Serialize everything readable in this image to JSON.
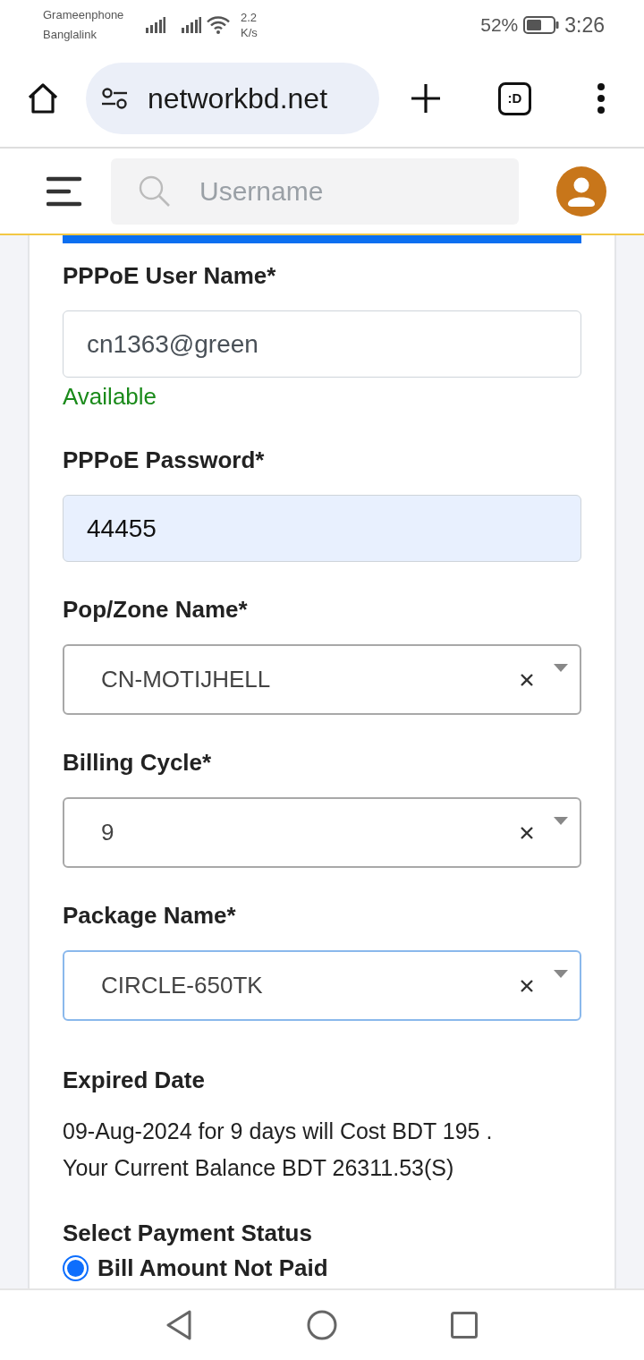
{
  "status_bar": {
    "carriers": [
      "Grameenphone",
      "Banglalink"
    ],
    "speed": [
      "2.2",
      "K/s"
    ],
    "battery": "52%",
    "time": "3:26"
  },
  "browser_bar": {
    "url": "networkbd.net",
    "tab_switcher": ":D"
  },
  "app_header": {
    "search": {
      "placeholder": "Username"
    }
  },
  "form": {
    "fields": [
      {
        "kind": "text",
        "label": "PPPoE User Name*",
        "value": "cn1363@green",
        "hint": "Available",
        "autofilled": false
      },
      {
        "kind": "text",
        "label": "PPPoE Password*",
        "value": "44455",
        "autofilled": true
      },
      {
        "kind": "select",
        "label": "Pop/Zone Name*",
        "value": "CN-MOTIJHELL",
        "focused": false
      },
      {
        "kind": "select",
        "label": "Billing Cycle*",
        "value": "9",
        "focused": false
      },
      {
        "kind": "select",
        "label": "Package Name*",
        "value": "CIRCLE-650TK",
        "focused": true
      }
    ],
    "expired_date": {
      "label": "Expired Date",
      "lines": [
        "09-Aug-2024 for 9 days will Cost BDT 195 .",
        "Your Current Balance BDT 26311.53(S)"
      ]
    },
    "payment_status": {
      "label": "Select Payment Status",
      "options": [
        {
          "label": "Bill Amount Not Paid",
          "selected": true
        }
      ]
    }
  }
}
